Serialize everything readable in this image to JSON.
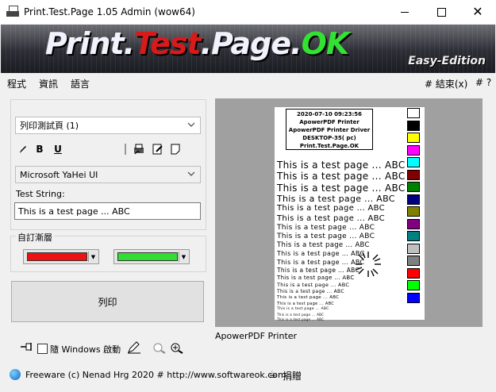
{
  "window": {
    "title": "Print.Test.Page 1.05 Admin (wow64)",
    "minimize_icon": "minimize-icon",
    "maximize_icon": "maximize-icon",
    "close_glyph": "✕"
  },
  "banner": {
    "part1": "Print.",
    "part2": "Test",
    "part3": ".Page.",
    "part4": "OK",
    "subtitle": "Easy-Edition"
  },
  "menu": {
    "items": [
      "程式",
      "資訊",
      "語言"
    ],
    "right": [
      "# 結束(x)",
      "# ?"
    ]
  },
  "left": {
    "page_select": "列印測試頁 (1)",
    "toolbar": {
      "bold": "B",
      "underline": "U"
    },
    "font_select": "Microsoft YaHei UI",
    "test_string_label": "Test String:",
    "test_string_value": "This is a test page ... ABC",
    "gradient_label": "自訂漸層",
    "gradient_color1": "#ee1111",
    "gradient_color2": "#33dd33",
    "print_button": "列印"
  },
  "preview": {
    "header": [
      "2020-07-10 09:23:56",
      "ApowerPDF Printer",
      "ApowerPDF Printer Driver",
      "DESKTOP-35( pc)",
      "Print.Test.Page.OK"
    ],
    "test_line": "This is a test page ... ABC",
    "swatches": [
      "#ffffff",
      "#000000",
      "#ffff00",
      "#ff00ff",
      "#00ffff",
      "#800000",
      "#008000",
      "#000080",
      "#808000",
      "#800080",
      "#008080",
      "#c0c0c0",
      "#808080",
      "#ff0000",
      "#00ff00",
      "#0000ff"
    ],
    "printer_name": "ApowerPDF Printer"
  },
  "bottom": {
    "startup_label": "隨 Windows 啟動"
  },
  "status": {
    "text": "Freeware (c) Nenad Hrg 2020 # http://www.softwareok.com",
    "donate": "捐贈"
  }
}
